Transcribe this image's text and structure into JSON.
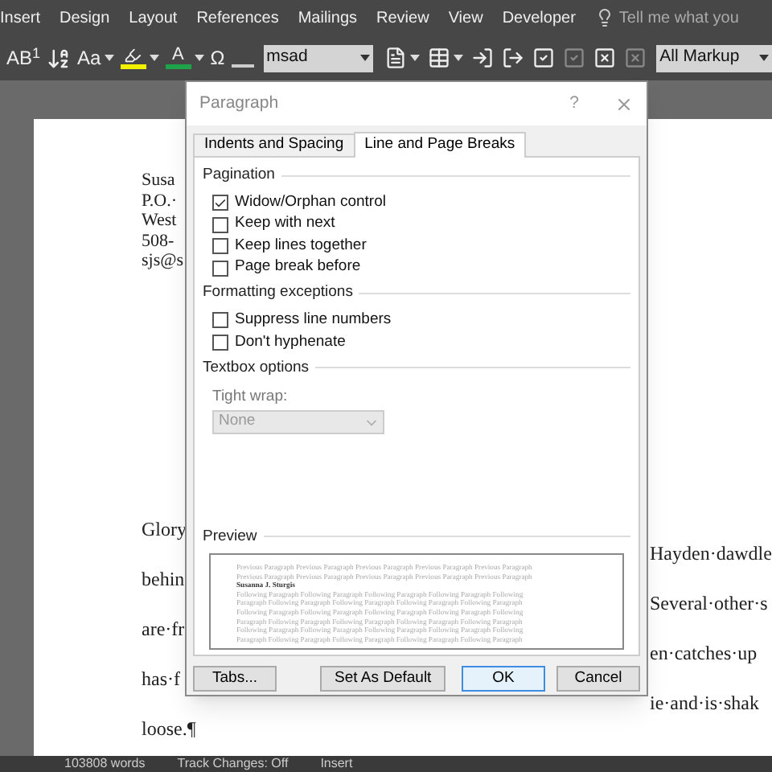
{
  "ribbon_tabs": [
    {
      "label": "Insert"
    },
    {
      "label": "Design"
    },
    {
      "label": "Layout"
    },
    {
      "label": "References"
    },
    {
      "label": "Mailings"
    },
    {
      "label": "Review"
    },
    {
      "label": "View"
    },
    {
      "label": "Developer"
    }
  ],
  "tell_me": {
    "placeholder": "Tell me what you"
  },
  "toolbar": {
    "left": [
      {
        "kind": "text",
        "text": "AB$^{1}$"
      },
      {
        "kind": "sort"
      },
      {
        "kind": "text",
        "text": "Aa",
        "dropdown": true
      },
      {
        "kind": "highlight",
        "color": "#f2f200",
        "dropdown": true
      },
      {
        "kind": "fontcolor",
        "text": "A",
        "color": "#1fa34a",
        "dropdown": true
      },
      {
        "kind": "text",
        "text": "Ω"
      },
      {
        "kind": "style"
      }
    ],
    "font_box": {
      "value": "msad"
    },
    "right": [
      {
        "kind": "doc",
        "dropdown": true
      },
      {
        "kind": "table",
        "dropdown": true
      },
      {
        "kind": "import"
      },
      {
        "kind": "export"
      },
      {
        "kind": "check",
        "disabled": false
      },
      {
        "kind": "check",
        "disabled": true
      },
      {
        "kind": "cross",
        "disabled": false
      },
      {
        "kind": "cross",
        "disabled": true
      }
    ],
    "markup_box": {
      "value": "All Markup"
    }
  },
  "document": {
    "address_lines": [
      "Susa",
      "P.O.·",
      "West",
      "508-",
      "sjs@s"
    ],
    "body_left": [
      "Glory",
      "behin",
      "are·fr",
      "has·f",
      "loose.¶"
    ],
    "body_right": [
      "Hayden·dawdle",
      "Several·other·s",
      "en·catches·up",
      "ie·and·is·shak"
    ]
  },
  "dialog": {
    "title": "Paragraph",
    "help": "?",
    "tabs": [
      {
        "label": "Indents and Spacing",
        "selected": false
      },
      {
        "label": "Line and Page Breaks",
        "selected": true
      }
    ],
    "sections": [
      {
        "title": "Pagination",
        "options": [
          {
            "label": "Widow/Orphan control",
            "checked": true
          },
          {
            "label": "Keep with next",
            "checked": false
          },
          {
            "label": "Keep lines together",
            "checked": false
          },
          {
            "label": "Page break before",
            "checked": false
          }
        ]
      },
      {
        "title": "Formatting exceptions",
        "options": [
          {
            "label": "Suppress line numbers",
            "checked": false
          },
          {
            "label": "Don't hyphenate",
            "checked": false
          }
        ]
      }
    ],
    "textbox": {
      "title": "Textbox options",
      "field_label": "Tight wrap:",
      "value": "None",
      "disabled": true
    },
    "preview": {
      "title": "Preview",
      "previous": [
        "Previous Paragraph Previous Paragraph Previous Paragraph Previous Paragraph Previous Paragraph",
        "Previous Paragraph Previous Paragraph Previous Paragraph Previous Paragraph Previous Paragraph"
      ],
      "sample": "Susanna J. Sturgis",
      "following": [
        "Following Paragraph Following Paragraph Following Paragraph Following Paragraph Following",
        "Paragraph Following Paragraph Following Paragraph Following Paragraph Following Paragraph",
        "Following Paragraph Following Paragraph Following Paragraph Following Paragraph Following",
        "Paragraph Following Paragraph Following Paragraph Following Paragraph Following Paragraph",
        "Following Paragraph Following Paragraph Following Paragraph Following Paragraph Following",
        "Paragraph Following Paragraph Following Paragraph Following Paragraph Following Paragraph"
      ]
    },
    "buttons": [
      {
        "label": "Tabs...",
        "default": false
      },
      {
        "label": "Set As Default",
        "default": false
      },
      {
        "label": "OK",
        "default": true
      },
      {
        "label": "Cancel",
        "default": false
      }
    ]
  },
  "status_bar": [
    "103808 words",
    "Track Changes: Off",
    "Insert"
  ]
}
